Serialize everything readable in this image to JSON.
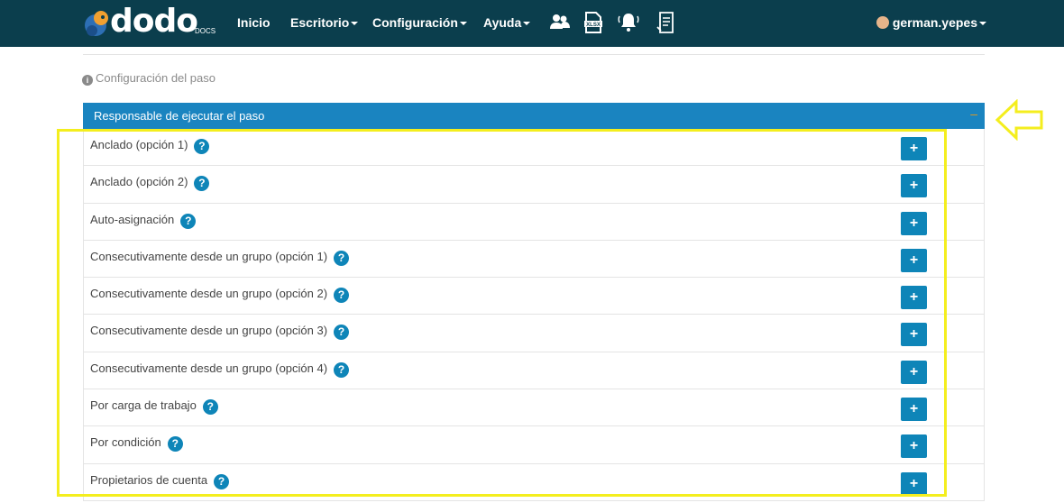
{
  "navbar": {
    "logo_text": "dodo",
    "logo_sub": "DOCS",
    "items": [
      {
        "label": "Inicio"
      },
      {
        "label": "Escritorio"
      },
      {
        "label": "Configuración"
      },
      {
        "label": "Ayuda"
      }
    ],
    "icons": [
      "users-icon",
      "xlsx-file-icon",
      "bell-icon",
      "document-icon"
    ],
    "user": "german.yepes"
  },
  "section": {
    "title": "Configuración del paso",
    "panel_title": "Responsable de ejecutar el paso",
    "collapse_label": "–"
  },
  "rows": [
    {
      "label": "Anclado (opción 1)"
    },
    {
      "label": "Anclado (opción 2)"
    },
    {
      "label": "Auto-asignación"
    },
    {
      "label": "Consecutivamente desde un grupo (opción 1)"
    },
    {
      "label": "Consecutivamente desde un grupo (opción 2)"
    },
    {
      "label": "Consecutivamente desde un grupo (opción 3)"
    },
    {
      "label": "Consecutivamente desde un grupo (opción 4)"
    },
    {
      "label": "Por carga de trabajo"
    },
    {
      "label": "Por condición"
    },
    {
      "label": "Propietarios de cuenta"
    }
  ],
  "help_glyph": "?",
  "add_glyph": "+",
  "colors": {
    "navbar": "#0b3e4d",
    "panel_header": "#1a84c0",
    "button": "#0e85b8",
    "highlight": "#f4ee1e"
  }
}
